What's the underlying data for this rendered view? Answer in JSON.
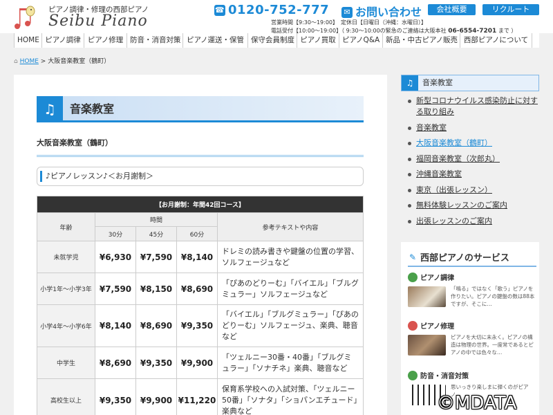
{
  "header": {
    "tagline": "ピアノ調律・修理の西部ピアノ",
    "brand": "Seibu Piano",
    "phone": "0120-752-777",
    "contact": "お問い合わせ",
    "buttons": [
      "会社概要",
      "リクルート"
    ],
    "hours_line": "営業時間【9:30～19:00】　定休日【日曜日（沖縄：水曜日）】",
    "phone_hours_prefix": "電話受付【10:00～19:00】（ 9:30～10:00の緊急のご連絡は大阪本社",
    "phone_hours_number": "06-6554-7201",
    "phone_hours_suffix": "まで ）"
  },
  "nav": [
    "HOME",
    "ピアノ調律",
    "ピアノ修理",
    "防音・消音対策",
    "ピアノ運送・保管",
    "保守会員制度",
    "ピアノ買取",
    "ピアノQ&A",
    "新品・中古ピアノ販売",
    "西部ピアノについて"
  ],
  "breadcrumb": {
    "home": "HOME",
    "separator": ">",
    "current": "大阪音楽教室（鶴町）"
  },
  "main": {
    "page_title": "音楽教室",
    "subtitle": "大阪音楽教室（鶴町）",
    "lesson_title": "♪ピアノレッスン♪＜お月謝制＞",
    "table": {
      "caption": "【お月謝制：年間42回コース】",
      "h_age": "年齢",
      "h_time": "時間",
      "h_ref": "参考テキストや内容",
      "durations": [
        "30分",
        "45分",
        "60分"
      ],
      "rows": [
        {
          "age": "未就学児",
          "p30": "¥6,930",
          "p45": "¥7,590",
          "p60": "¥8,140",
          "ref": "ドレミの読み書きや鍵盤の位置の学習、ソルフェージュなど"
        },
        {
          "age": "小学1年〜小学3年",
          "p30": "¥7,590",
          "p45": "¥8,150",
          "p60": "¥8,690",
          "ref": "「ぴあのどりーむ」「バイエル」「ブルグミュラー」ソルフェージュなど"
        },
        {
          "age": "小学4年〜小学6年",
          "p30": "¥8,140",
          "p45": "¥8,690",
          "p60": "¥9,350",
          "ref": "「バイエル」「ブルグミュラー」「ぴあのどりーむ」ソルフェージュ、楽典、聴音　など"
        },
        {
          "age": "中学生",
          "p30": "¥8,690",
          "p45": "¥9,350",
          "p60": "¥9,900",
          "ref": "「ツェルニー30番・40番」「ブルグミュラー」「ソナチネ」楽典、聴音など"
        },
        {
          "age": "高校生以上",
          "p30": "¥9,350",
          "p45": "¥9,900",
          "p60": "¥11,220",
          "ref": "保育系学校への入試対策、「ツェルニー50番」「ソナタ」「ショパンエチュード」楽典など"
        }
      ]
    }
  },
  "sidebar": {
    "title": "音楽教室",
    "items": [
      {
        "label": "新型コロナウイルス感染防止に対する取り組み"
      },
      {
        "label": "音楽教室"
      },
      {
        "label": "大阪音楽教室（鶴町）"
      },
      {
        "label": "福岡音楽教室（次郎丸）"
      },
      {
        "label": "沖縄音楽教室"
      },
      {
        "label": "東京（出張レッスン）"
      },
      {
        "label": "無料体験レッスンのご案内"
      },
      {
        "label": "出張レッスンのご案内"
      }
    ],
    "services_title": "西部ピアノのサービス",
    "services": [
      {
        "title": "ピアノ調律",
        "color": "#4aa04a",
        "desc": "「鳴る」ではなく「歌う」ピアノを作りたい。ピアノの鍵盤の数は88本ですが、そこに…"
      },
      {
        "title": "ピアノ修理",
        "color": "#d9534f",
        "desc": "ピアノを大切に末永く。ピアノの構造は物理の世界。一度常であるとピアノの中では色々な…"
      },
      {
        "title": "防音・消音対策",
        "color": "#4aa04a",
        "desc": "思いっきり楽しまに弾くのがピアノ…"
      }
    ]
  },
  "copyright": "©MDATA",
  "colors": {
    "accent": "#1c8ad6",
    "table_header": "#333333"
  }
}
